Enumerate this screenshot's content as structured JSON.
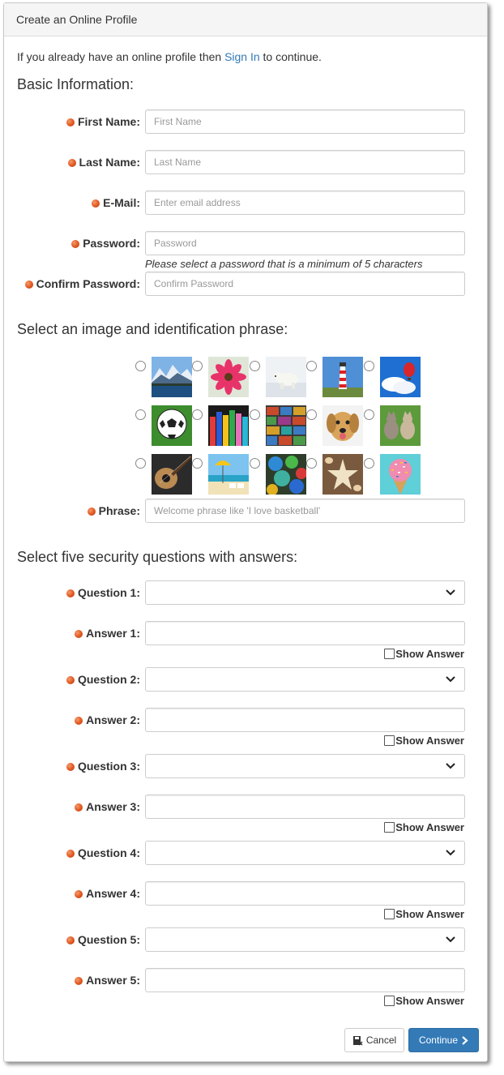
{
  "panel_title": "Create an Online Profile",
  "intro": {
    "before": "If you already have an online profile then ",
    "link": "Sign In",
    "after": " to continue."
  },
  "basic": {
    "heading": "Basic Information:",
    "first_name": {
      "label": "First Name:",
      "placeholder": "First Name"
    },
    "last_name": {
      "label": "Last Name:",
      "placeholder": "Last Name"
    },
    "email": {
      "label": "E-Mail:",
      "placeholder": "Enter email address"
    },
    "password": {
      "label": "Password:",
      "placeholder": "Password",
      "help": "Please select a password that is a minimum of 5 characters"
    },
    "confirm": {
      "label": "Confirm Password:",
      "placeholder": "Confirm Password"
    }
  },
  "image_section": {
    "heading": "Select an image and identification phrase:",
    "images": [
      "mountain-lake",
      "pink-flower",
      "polar-bear",
      "lighthouse",
      "hot-air-balloon",
      "soccer-ball",
      "crayons",
      "colored-boxes",
      "dog",
      "cats",
      "guitar",
      "beach",
      "marbles",
      "starfish-shells",
      "sprinkle-ice-cream"
    ],
    "phrase": {
      "label": "Phrase:",
      "placeholder": "Welcome phrase like 'I love basketball'"
    }
  },
  "security": {
    "heading": "Select five security questions with answers:",
    "show_answer_label": "Show Answer",
    "items": [
      {
        "q_label": "Question 1:",
        "a_label": "Answer 1:"
      },
      {
        "q_label": "Question 2:",
        "a_label": "Answer 2:"
      },
      {
        "q_label": "Question 3:",
        "a_label": "Answer 3:"
      },
      {
        "q_label": "Question 4:",
        "a_label": "Answer 4:"
      },
      {
        "q_label": "Question 5:",
        "a_label": "Answer 5:"
      }
    ]
  },
  "buttons": {
    "cancel": "Cancel",
    "continue": "Continue"
  },
  "colors": {
    "accent": "#337ab7",
    "required_dot": "#e0571f"
  }
}
